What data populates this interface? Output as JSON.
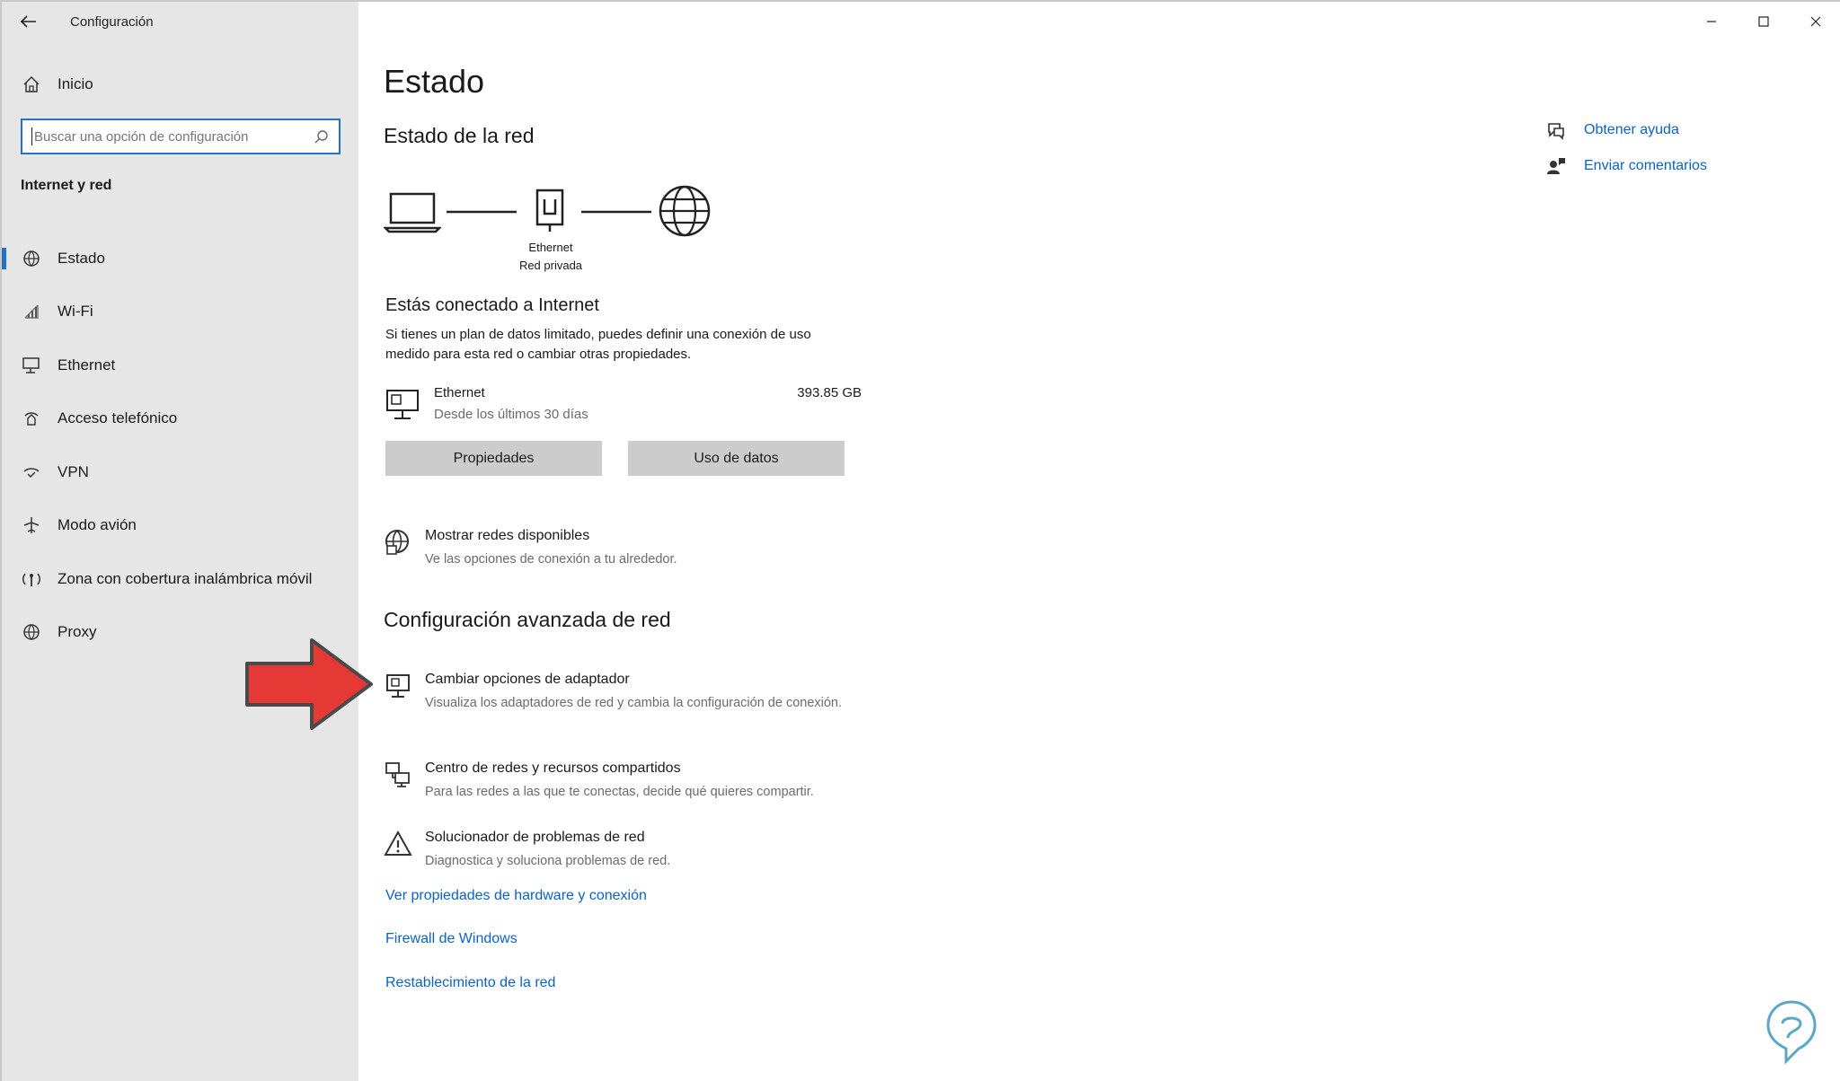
{
  "titlebar": {
    "app_title": "Configuración"
  },
  "sidebar": {
    "home_label": "Inicio",
    "search_placeholder": "Buscar una opción de configuración",
    "section_label": "Internet y red",
    "items": [
      {
        "label": "Estado",
        "icon": "status-globe-icon",
        "active": true
      },
      {
        "label": "Wi-Fi",
        "icon": "wifi-icon",
        "active": false
      },
      {
        "label": "Ethernet",
        "icon": "ethernet-icon",
        "active": false
      },
      {
        "label": "Acceso telefónico",
        "icon": "dialup-icon",
        "active": false
      },
      {
        "label": "VPN",
        "icon": "vpn-icon",
        "active": false
      },
      {
        "label": "Modo avión",
        "icon": "airplane-icon",
        "active": false
      },
      {
        "label": "Zona con cobertura inalámbrica móvil",
        "icon": "hotspot-icon",
        "active": false
      },
      {
        "label": "Proxy",
        "icon": "proxy-globe-icon",
        "active": false
      }
    ]
  },
  "main": {
    "page_title": "Estado",
    "network_status_heading": "Estado de la red",
    "diagram": {
      "adapter_name": "Ethernet",
      "network_type": "Red privada"
    },
    "connected_title": "Estás conectado a Internet",
    "connected_desc": "Si tienes un plan de datos limitado, puedes definir una conexión de uso medido para esta red o cambiar otras propiedades.",
    "usage": {
      "name": "Ethernet",
      "period": "Desde los últimos 30 días",
      "amount": "393.85 GB"
    },
    "buttons": {
      "properties": "Propiedades",
      "data_usage": "Uso de datos"
    },
    "show_networks": {
      "title": "Mostrar redes disponibles",
      "desc": "Ve las opciones de conexión a tu alrededor."
    },
    "advanced_heading": "Configuración avanzada de red",
    "advanced_options": [
      {
        "title": "Cambiar opciones de adaptador",
        "desc": "Visualiza los adaptadores de red y cambia la configuración de conexión."
      },
      {
        "title": "Centro de redes y recursos compartidos",
        "desc": "Para las redes a las que te conectas, decide qué quieres compartir."
      },
      {
        "title": "Solucionador de problemas de red",
        "desc": "Diagnostica y soluciona problemas de red."
      }
    ],
    "links": [
      "Ver propiedades de hardware y conexión",
      "Firewall de Windows",
      "Restablecimiento de la red"
    ]
  },
  "help": {
    "get_help": "Obtener ayuda",
    "feedback": "Enviar comentarios"
  },
  "colors": {
    "accent": "#0a63c4",
    "sidebar_bg": "#e6e6e6",
    "arrow": "#e53935",
    "button_bg": "#cccccc"
  }
}
